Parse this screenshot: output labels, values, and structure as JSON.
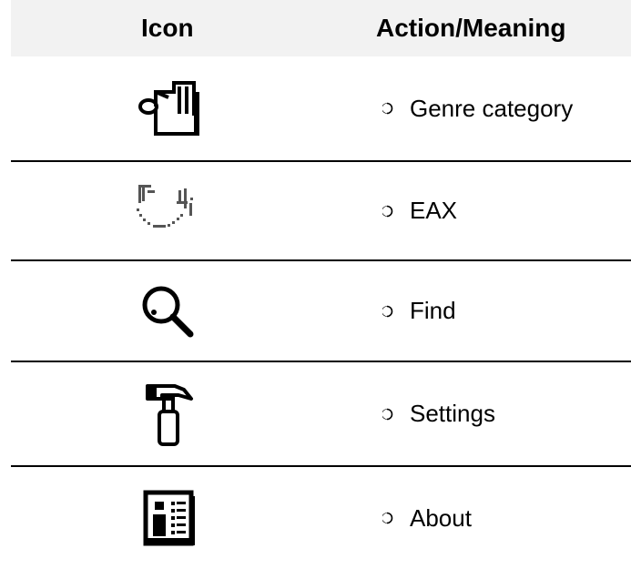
{
  "table": {
    "headers": {
      "icon": "Icon",
      "action": "Action/Meaning"
    },
    "rows": [
      {
        "icon": "genre-music-folder-icon",
        "label": "Genre category"
      },
      {
        "icon": "eax-icon",
        "label": "EAX"
      },
      {
        "icon": "magnifier-icon",
        "label": "Find"
      },
      {
        "icon": "hammer-icon",
        "label": "Settings"
      },
      {
        "icon": "info-document-icon",
        "label": "About"
      }
    ]
  }
}
